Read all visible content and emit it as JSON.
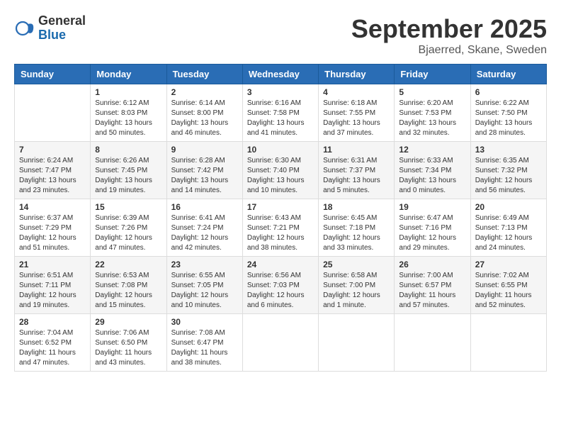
{
  "logo": {
    "general": "General",
    "blue": "Blue"
  },
  "title": "September 2025",
  "location": "Bjaerred, Skane, Sweden",
  "days_header": [
    "Sunday",
    "Monday",
    "Tuesday",
    "Wednesday",
    "Thursday",
    "Friday",
    "Saturday"
  ],
  "weeks": [
    [
      {
        "day": "",
        "info": ""
      },
      {
        "day": "1",
        "info": "Sunrise: 6:12 AM\nSunset: 8:03 PM\nDaylight: 13 hours\nand 50 minutes."
      },
      {
        "day": "2",
        "info": "Sunrise: 6:14 AM\nSunset: 8:00 PM\nDaylight: 13 hours\nand 46 minutes."
      },
      {
        "day": "3",
        "info": "Sunrise: 6:16 AM\nSunset: 7:58 PM\nDaylight: 13 hours\nand 41 minutes."
      },
      {
        "day": "4",
        "info": "Sunrise: 6:18 AM\nSunset: 7:55 PM\nDaylight: 13 hours\nand 37 minutes."
      },
      {
        "day": "5",
        "info": "Sunrise: 6:20 AM\nSunset: 7:53 PM\nDaylight: 13 hours\nand 32 minutes."
      },
      {
        "day": "6",
        "info": "Sunrise: 6:22 AM\nSunset: 7:50 PM\nDaylight: 13 hours\nand 28 minutes."
      }
    ],
    [
      {
        "day": "7",
        "info": "Sunrise: 6:24 AM\nSunset: 7:47 PM\nDaylight: 13 hours\nand 23 minutes."
      },
      {
        "day": "8",
        "info": "Sunrise: 6:26 AM\nSunset: 7:45 PM\nDaylight: 13 hours\nand 19 minutes."
      },
      {
        "day": "9",
        "info": "Sunrise: 6:28 AM\nSunset: 7:42 PM\nDaylight: 13 hours\nand 14 minutes."
      },
      {
        "day": "10",
        "info": "Sunrise: 6:30 AM\nSunset: 7:40 PM\nDaylight: 13 hours\nand 10 minutes."
      },
      {
        "day": "11",
        "info": "Sunrise: 6:31 AM\nSunset: 7:37 PM\nDaylight: 13 hours\nand 5 minutes."
      },
      {
        "day": "12",
        "info": "Sunrise: 6:33 AM\nSunset: 7:34 PM\nDaylight: 13 hours\nand 0 minutes."
      },
      {
        "day": "13",
        "info": "Sunrise: 6:35 AM\nSunset: 7:32 PM\nDaylight: 12 hours\nand 56 minutes."
      }
    ],
    [
      {
        "day": "14",
        "info": "Sunrise: 6:37 AM\nSunset: 7:29 PM\nDaylight: 12 hours\nand 51 minutes."
      },
      {
        "day": "15",
        "info": "Sunrise: 6:39 AM\nSunset: 7:26 PM\nDaylight: 12 hours\nand 47 minutes."
      },
      {
        "day": "16",
        "info": "Sunrise: 6:41 AM\nSunset: 7:24 PM\nDaylight: 12 hours\nand 42 minutes."
      },
      {
        "day": "17",
        "info": "Sunrise: 6:43 AM\nSunset: 7:21 PM\nDaylight: 12 hours\nand 38 minutes."
      },
      {
        "day": "18",
        "info": "Sunrise: 6:45 AM\nSunset: 7:18 PM\nDaylight: 12 hours\nand 33 minutes."
      },
      {
        "day": "19",
        "info": "Sunrise: 6:47 AM\nSunset: 7:16 PM\nDaylight: 12 hours\nand 29 minutes."
      },
      {
        "day": "20",
        "info": "Sunrise: 6:49 AM\nSunset: 7:13 PM\nDaylight: 12 hours\nand 24 minutes."
      }
    ],
    [
      {
        "day": "21",
        "info": "Sunrise: 6:51 AM\nSunset: 7:11 PM\nDaylight: 12 hours\nand 19 minutes."
      },
      {
        "day": "22",
        "info": "Sunrise: 6:53 AM\nSunset: 7:08 PM\nDaylight: 12 hours\nand 15 minutes."
      },
      {
        "day": "23",
        "info": "Sunrise: 6:55 AM\nSunset: 7:05 PM\nDaylight: 12 hours\nand 10 minutes."
      },
      {
        "day": "24",
        "info": "Sunrise: 6:56 AM\nSunset: 7:03 PM\nDaylight: 12 hours\nand 6 minutes."
      },
      {
        "day": "25",
        "info": "Sunrise: 6:58 AM\nSunset: 7:00 PM\nDaylight: 12 hours\nand 1 minute."
      },
      {
        "day": "26",
        "info": "Sunrise: 7:00 AM\nSunset: 6:57 PM\nDaylight: 11 hours\nand 57 minutes."
      },
      {
        "day": "27",
        "info": "Sunrise: 7:02 AM\nSunset: 6:55 PM\nDaylight: 11 hours\nand 52 minutes."
      }
    ],
    [
      {
        "day": "28",
        "info": "Sunrise: 7:04 AM\nSunset: 6:52 PM\nDaylight: 11 hours\nand 47 minutes."
      },
      {
        "day": "29",
        "info": "Sunrise: 7:06 AM\nSunset: 6:50 PM\nDaylight: 11 hours\nand 43 minutes."
      },
      {
        "day": "30",
        "info": "Sunrise: 7:08 AM\nSunset: 6:47 PM\nDaylight: 11 hours\nand 38 minutes."
      },
      {
        "day": "",
        "info": ""
      },
      {
        "day": "",
        "info": ""
      },
      {
        "day": "",
        "info": ""
      },
      {
        "day": "",
        "info": ""
      }
    ]
  ]
}
